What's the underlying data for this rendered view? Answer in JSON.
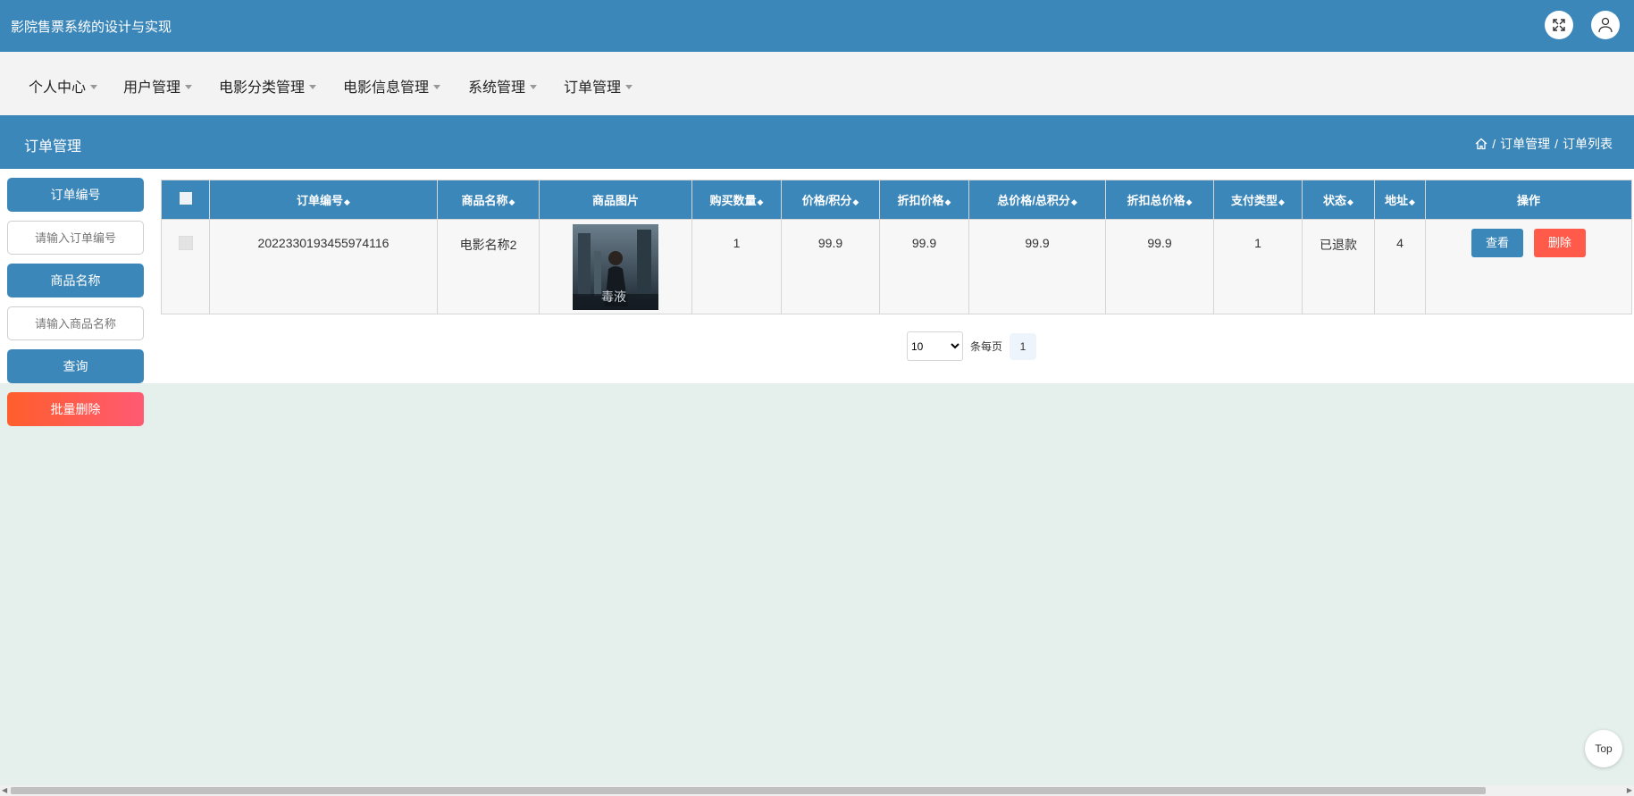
{
  "header": {
    "app_title": "影院售票系统的设计与实现"
  },
  "nav": [
    {
      "label": "个人中心"
    },
    {
      "label": "用户管理"
    },
    {
      "label": "电影分类管理"
    },
    {
      "label": "电影信息管理"
    },
    {
      "label": "系统管理"
    },
    {
      "label": "订单管理"
    }
  ],
  "page": {
    "title": "订单管理",
    "breadcrumb": [
      "订单管理",
      "订单列表"
    ]
  },
  "search": {
    "order_no_label": "订单编号",
    "order_no_placeholder": "请输入订单编号",
    "product_name_label": "商品名称",
    "product_name_placeholder": "请输入商品名称",
    "query_label": "查询",
    "batch_delete_label": "批量删除"
  },
  "table": {
    "headers": [
      "订单编号",
      "商品名称",
      "商品图片",
      "购买数量",
      "价格/积分",
      "折扣价格",
      "总价格/总积分",
      "折扣总价格",
      "支付类型",
      "状态",
      "地址",
      "操作"
    ],
    "rows": [
      {
        "order_no": "2022330193455974116",
        "product_name": "电影名称2",
        "image_text": "毒液",
        "quantity": "1",
        "price": "99.9",
        "discount_price": "99.9",
        "total_price": "99.9",
        "discount_total": "99.9",
        "pay_type": "1",
        "status": "已退款",
        "address": "4",
        "view_label": "查看",
        "delete_label": "删除"
      }
    ]
  },
  "pagination": {
    "page_size": "10",
    "per_page_label": "条每页",
    "current_page": "1"
  },
  "top_button": "Top",
  "colors": {
    "primary": "#3c87ba",
    "danger": "#ff5a4a",
    "background": "#e5f0ec"
  }
}
